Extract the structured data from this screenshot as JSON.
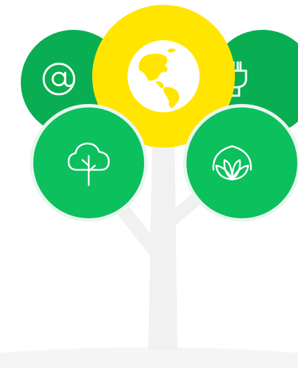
{
  "colors": {
    "green": "#0cc05e",
    "green_dark": "#0aae52",
    "yellow": "#ffe500",
    "trunk": "#f1f1f1",
    "ground": "#f5f5f5",
    "ring": "#e9f6ee",
    "white": "#ffffff"
  },
  "icons": {
    "email": "at-sign-icon",
    "globe": "globe-americas-icon",
    "energy": "plug-icon",
    "tree": "tree-icon",
    "plant": "leaf-sprout-icon"
  }
}
